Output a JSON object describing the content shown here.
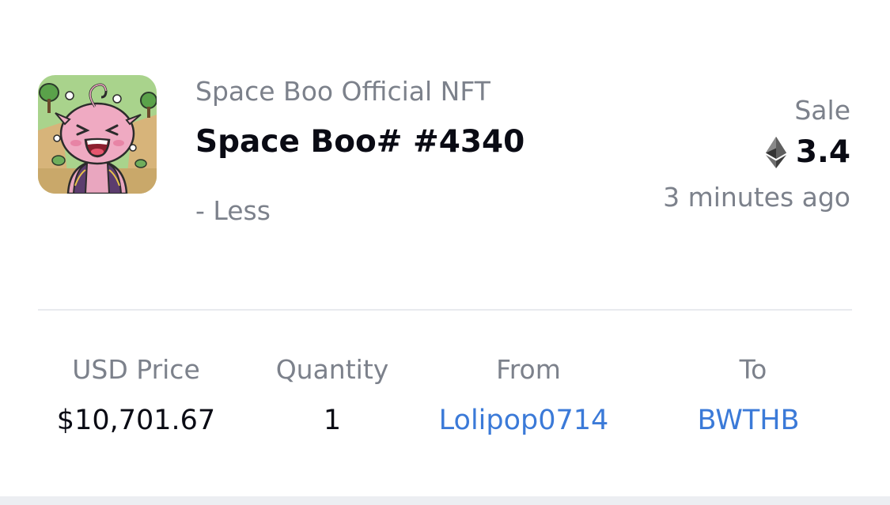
{
  "item": {
    "collection": "Space Boo Official NFT",
    "name": "Space Boo# #4340",
    "toggle_label": "- Less",
    "image_icon": "nft-thumbnail-pink-boo-character"
  },
  "event": {
    "type": "Sale",
    "currency_icon": "ethereum-icon",
    "price": "3.4",
    "time_ago": "3 minutes ago"
  },
  "details": {
    "usd_price_label": "USD Price",
    "usd_price_value": "$10,701.67",
    "quantity_label": "Quantity",
    "quantity_value": "1",
    "from_label": "From",
    "from_value": "Lolipop0714",
    "to_label": "To",
    "to_value": "BWTHB"
  },
  "colors": {
    "muted_text": "#7c818b",
    "primary_text": "#0a0b14",
    "link": "#3b7ad8",
    "divider": "#e8eaee"
  }
}
